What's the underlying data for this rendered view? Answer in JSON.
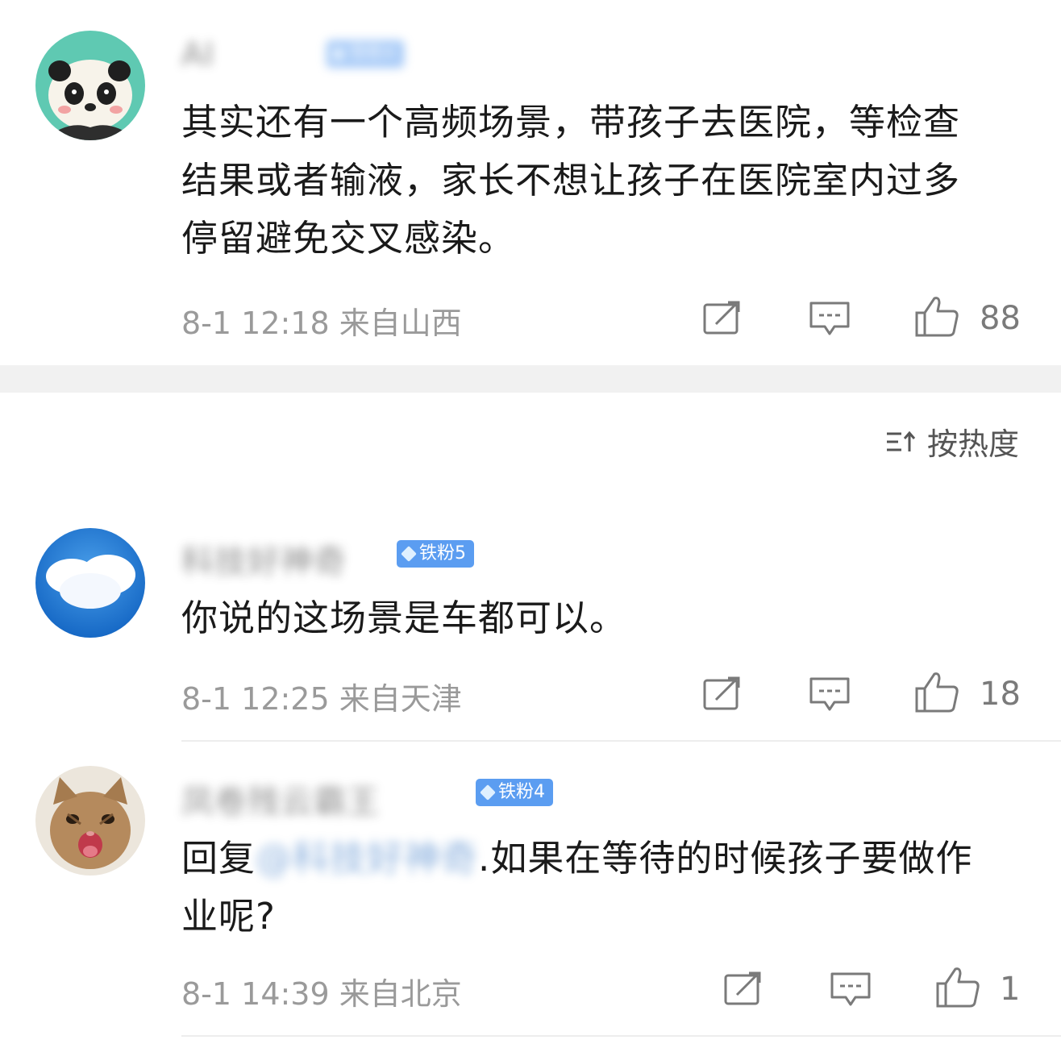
{
  "sort": {
    "label": "按热度"
  },
  "comments": [
    {
      "username": "AI",
      "badge": "铁粉4",
      "text": "其实还有一个高频场景，带孩子去医院，等检查结果或者输液，家长不想让孩子在医院室内过多停留避免交叉感染。",
      "meta": "8-1 12:18 来自山西",
      "likes": "88"
    },
    {
      "username": "科技好神奇",
      "badge": "铁粉5",
      "text": "你说的这场景是车都可以。",
      "meta": "8-1 12:25 来自天津",
      "likes": "18"
    },
    {
      "username": "凤卷残云霸王",
      "badge": "铁粉4",
      "reply_prefix": "回复",
      "mention": "@科技好神奇",
      "text": ".如果在等待的时候孩子要做作业呢?",
      "meta": "8-1 14:39 来自北京",
      "likes": "1"
    }
  ]
}
